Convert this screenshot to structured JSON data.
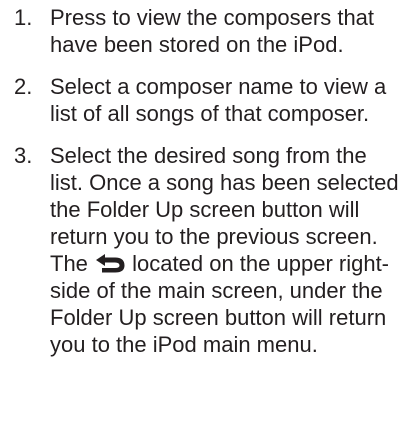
{
  "steps": [
    {
      "number": "1.",
      "text": "Press to view the composers that have been stored on the iPod."
    },
    {
      "number": "2.",
      "text": "Select a composer name to view a list of all songs of that composer."
    },
    {
      "number": "3.",
      "text_before_icon": "Select the desired song from the list. Once a song has been selected the Folder Up screen button will return you to the previous screen. The",
      "icon": "u-turn-back-arrow-icon",
      "text_after_icon": "located on the upper right-side of the main screen, under the Folder Up screen button will return you to the iPod main menu."
    }
  ],
  "colors": {
    "text": "#231f20",
    "background": "#ffffff"
  }
}
